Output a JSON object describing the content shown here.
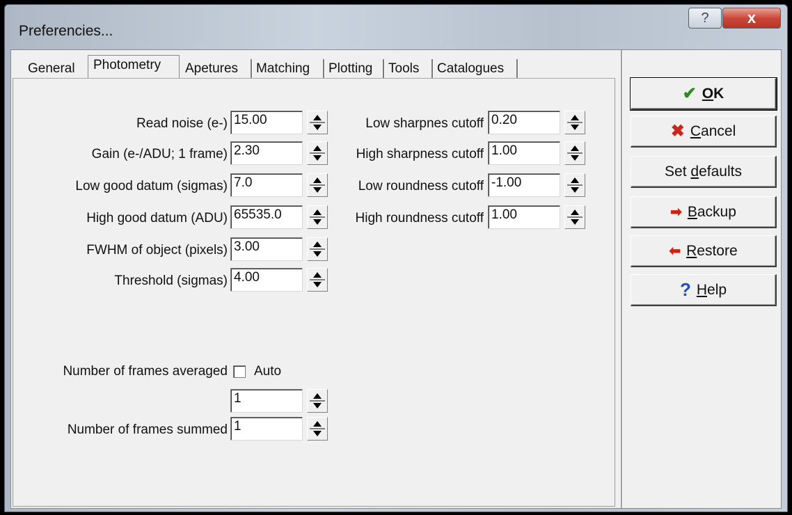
{
  "window": {
    "title": "Preferencies...",
    "help_glyph": "?",
    "close_glyph": "x"
  },
  "tabs": [
    "General",
    "Photometry",
    "Apetures",
    "Matching",
    "Plotting",
    "Tools",
    "Catalogues"
  ],
  "left_fields": [
    {
      "label": "Read noise (e-)",
      "value": "15.00"
    },
    {
      "label": "Gain (e-/ADU; 1 frame)",
      "value": "2.30"
    },
    {
      "label": "Low good datum (sigmas)",
      "value": "7.0"
    },
    {
      "label": "High good datum (ADU)",
      "value": "65535.0"
    },
    {
      "label": "FWHM of object (pixels)",
      "value": "3.00"
    },
    {
      "label": "Threshold (sigmas)",
      "value": "4.00"
    }
  ],
  "right_fields": [
    {
      "label": "Low sharpnes cutoff",
      "value": "0.20"
    },
    {
      "label": "High sharpness cutoff",
      "value": "1.00"
    },
    {
      "label": "Low roundness cutoff",
      "value": "-1.00"
    },
    {
      "label": "High roundness cutoff",
      "value": "1.00"
    }
  ],
  "frames": {
    "averaged_label": "Number of frames averaged",
    "auto_label": "Auto",
    "auto_checked": false,
    "averaged_value": "1",
    "summed_label": "Number of frames summed",
    "summed_value": "1"
  },
  "buttons": {
    "ok": {
      "accel": "O",
      "rest": "K",
      "icon": "✔"
    },
    "cancel": {
      "accel": "C",
      "rest": "ancel",
      "icon": "✖"
    },
    "set_defaults": {
      "pre": "Set ",
      "accel": "d",
      "rest": "efaults"
    },
    "backup": {
      "accel": "B",
      "rest": "ackup",
      "icon": "➡"
    },
    "restore": {
      "accel": "R",
      "rest": "estore",
      "icon": "⬅"
    },
    "help": {
      "accel": "H",
      "rest": "elp",
      "icon": "?"
    }
  },
  "colors": {
    "ok_icon": "#2e8b1e",
    "cancel_icon": "#c8281e",
    "help_icon": "#1f4fb0",
    "arrow_icon": "#d02010"
  }
}
